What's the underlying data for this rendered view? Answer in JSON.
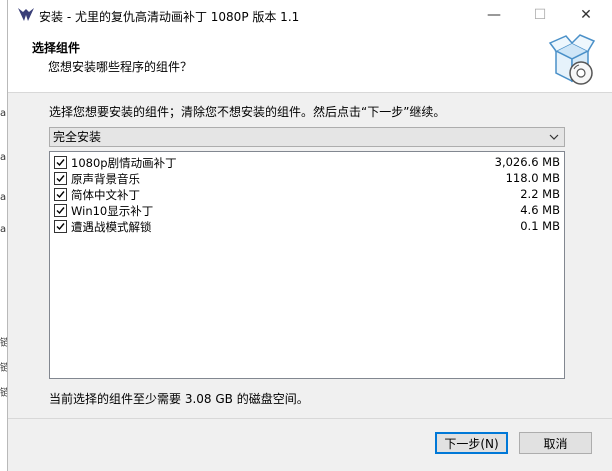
{
  "window": {
    "title": "安装 - 尤里的复仇高清动画补丁 1080P 版本 1.1",
    "minimize_glyph": "—",
    "maximize_glyph": "☐",
    "close_glyph": "✕"
  },
  "header": {
    "title": "选择组件",
    "subtitle": "您想安装哪些程序的组件？"
  },
  "instruction": "选择您想要安装的组件；清除您不想安装的组件。然后点击“下一步”继续。",
  "setup_type": {
    "selected": "完全安装"
  },
  "components": [
    {
      "name": "1080p剧情动画补丁",
      "size": "3,026.6 MB",
      "checked": true
    },
    {
      "name": "原声背景音乐",
      "size": "118.0 MB",
      "checked": true
    },
    {
      "name": "简体中文补丁",
      "size": "2.2 MB",
      "checked": true
    },
    {
      "name": "Win10显示补丁",
      "size": "4.6 MB",
      "checked": true
    },
    {
      "name": "遭遇战模式解锁",
      "size": "0.1 MB",
      "checked": true
    }
  ],
  "space_required": "当前选择的组件至少需要 3.08 GB 的磁盘空间。",
  "buttons": {
    "next": "下一步(N)",
    "cancel": "取消"
  },
  "left_strip": [
    "a",
    "a",
    "a",
    "a",
    "链",
    "链",
    "链"
  ]
}
